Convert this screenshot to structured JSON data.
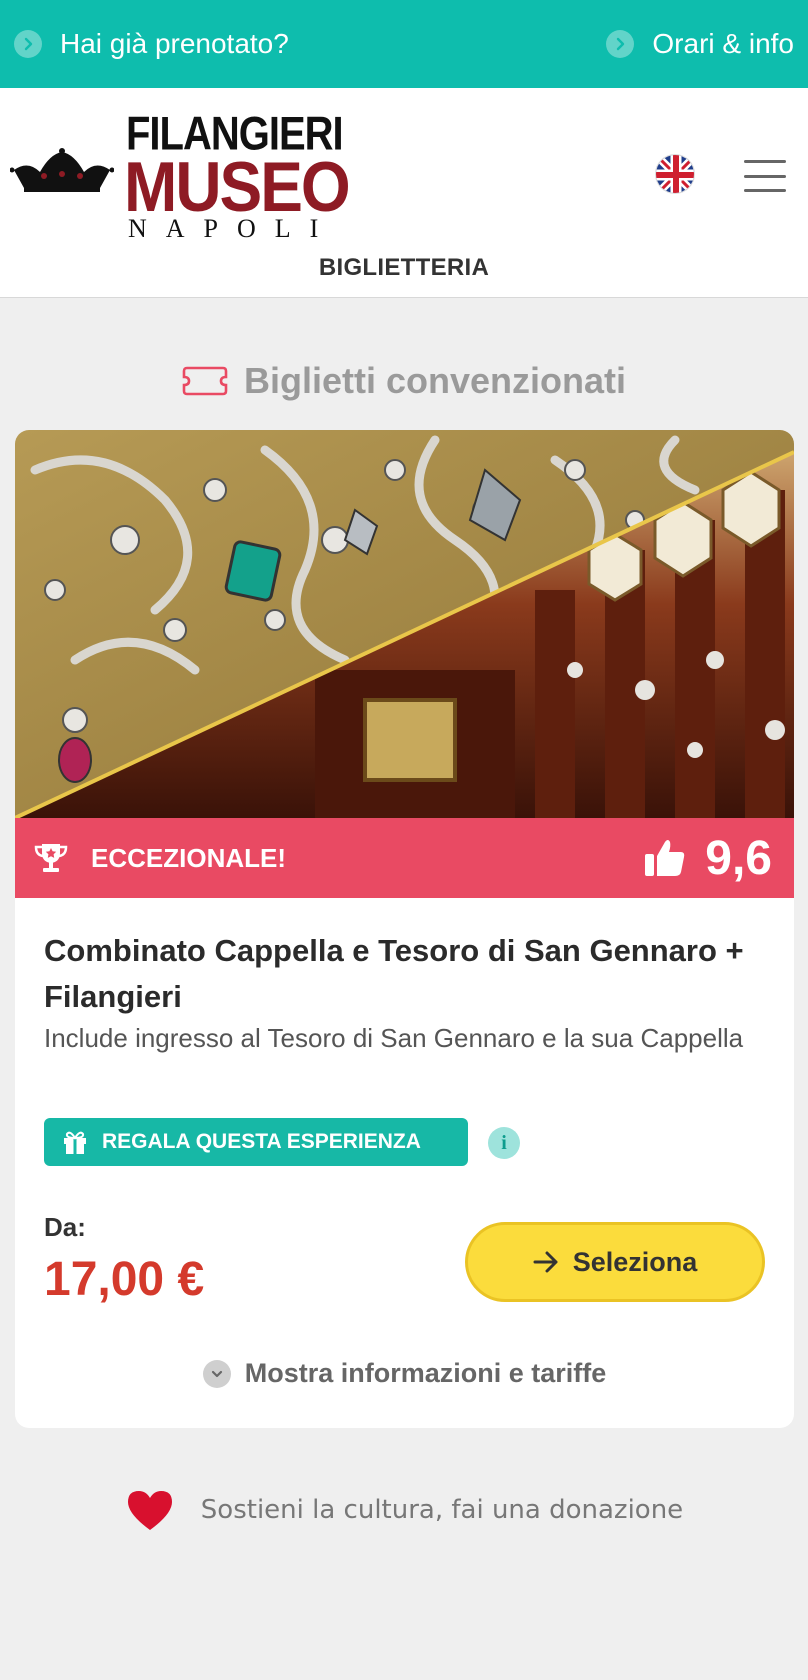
{
  "topbar": {
    "left_link": "Hai già prenotato?",
    "right_link": "Orari & info"
  },
  "header": {
    "logo": {
      "line1": "FILANGIERI",
      "line2": "MUSEO",
      "line3": "NAPOLI"
    },
    "language_icon": "uk-flag-icon",
    "menu_icon": "hamburger-menu-icon",
    "nav_label": "BIGLIETTERIA"
  },
  "section": {
    "title": "Biglietti convenzionati",
    "icon": "ticket-icon"
  },
  "card": {
    "rating_label": "ECCEZIONALE!",
    "rating_score": "9,6",
    "title": "Combinato Cappella e Tesoro di San Gennaro + Filangieri",
    "description": "Include ingresso al Tesoro di San Gennaro e la sua Cappella",
    "gift_button": "REGALA QUESTA ESPERIENZA",
    "price_label": "Da:",
    "price_value": "17,00 €",
    "select_button": "Seleziona",
    "more_info": "Mostra informazioni e tariffe"
  },
  "donation": {
    "text": "Sostieni la cultura, fai una donazione"
  },
  "colors": {
    "teal": "#0ebdad",
    "rating_red": "#e94a63",
    "price_red": "#d43a2c",
    "select_yellow": "#fbdc3c",
    "brand_burgundy": "#8e1b24"
  }
}
